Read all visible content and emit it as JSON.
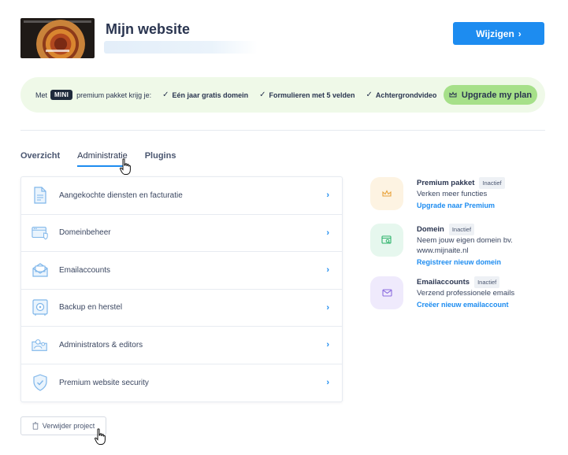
{
  "header": {
    "site_title": "Mijn website",
    "edit_button": "Wijzigen",
    "edit_arrow": "›"
  },
  "promo": {
    "prefix": "Met",
    "plan_badge": "MINI",
    "suffix": "premium pakket krijg je:",
    "features": [
      "Eén jaar gratis domein",
      "Formulieren met 5 velden",
      "Achtergrondvideo"
    ],
    "check": "✓",
    "upgrade_button": "Upgrade my plan"
  },
  "tabs": [
    {
      "label": "Overzicht"
    },
    {
      "label": "Administratie",
      "active": true
    },
    {
      "label": "Plugins"
    }
  ],
  "admin_items": [
    {
      "label": "Aangekochte diensten en facturatie",
      "icon": "document-icon"
    },
    {
      "label": "Domeinbeheer",
      "icon": "domain-icon"
    },
    {
      "label": "Emailaccounts",
      "icon": "mail-icon"
    },
    {
      "label": "Backup en herstel",
      "icon": "safe-icon"
    },
    {
      "label": "Administrators & editors",
      "icon": "users-icon"
    },
    {
      "label": "Premium website security",
      "icon": "shield-icon"
    }
  ],
  "chevron": "›",
  "side": {
    "premium": {
      "title": "Premium pakket",
      "badge": "Inactief",
      "desc": "Verken meer functies",
      "link": "Upgrade naar Premium"
    },
    "domain": {
      "title": "Domein",
      "badge": "Inactief",
      "desc1": "Neem jouw eigen domein bv.",
      "desc2": "www.mijnaite.nl",
      "link": "Registreer nieuw domein"
    },
    "email": {
      "title": "Emailaccounts",
      "badge": "Inactief",
      "desc": "Verzend professionele emails",
      "link": "Creëer nieuw emailaccount"
    }
  },
  "delete_button": "Verwijder project",
  "colors": {
    "primary": "#1d8cf0",
    "promo_bg": "#eff9e8",
    "upgrade_bg": "#a6e089",
    "text": "#2a3550"
  }
}
